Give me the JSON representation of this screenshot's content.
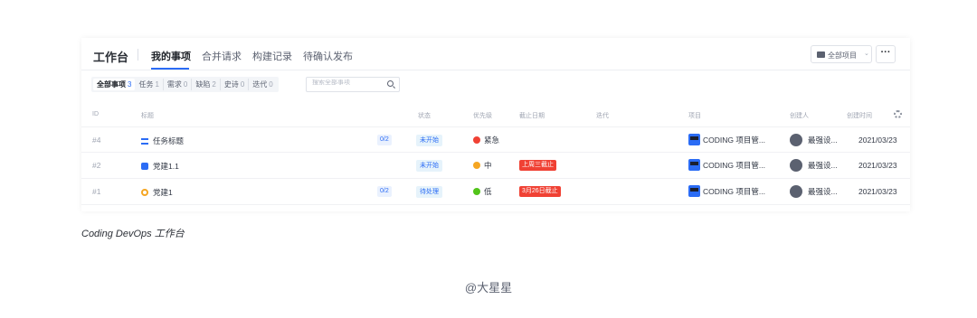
{
  "header": {
    "title": "工作台",
    "tabs": [
      {
        "label": "我的事项",
        "active": true
      },
      {
        "label": "合并请求"
      },
      {
        "label": "构建记录"
      },
      {
        "label": "待确认发布"
      }
    ],
    "project_select": "全部项目",
    "project_caret": "⌄",
    "more": "···"
  },
  "filters": [
    {
      "label": "全部事项",
      "count": "3",
      "active": true
    },
    {
      "label": "任务",
      "count": "1"
    },
    {
      "label": "需求",
      "count": "0"
    },
    {
      "label": "缺陷",
      "count": "2"
    },
    {
      "label": "史诗",
      "count": "0"
    },
    {
      "label": "迭代",
      "count": "0"
    }
  ],
  "search": {
    "placeholder": "搜索全部事项"
  },
  "table": {
    "columns": [
      "ID",
      "标题",
      "状态",
      "优先级",
      "截止日期",
      "迭代",
      "项目",
      "创建人",
      "创建时间"
    ],
    "rows": [
      {
        "id": "#4",
        "type": "task",
        "title": "任务标题",
        "subtasks": "0/2",
        "status": "未开始",
        "priority": "紧急",
        "priority_color": "#f04134",
        "due": "",
        "project": "CODING 项目管...",
        "creator": "最强设...",
        "created": "2021/03/23"
      },
      {
        "id": "#2",
        "type": "requirement",
        "title": "党建1.1",
        "subtasks": "",
        "status": "未开始",
        "priority": "中",
        "priority_color": "#f5a623",
        "due": "上周三截止",
        "project": "CODING 项目管...",
        "creator": "最强设...",
        "created": "2021/03/23"
      },
      {
        "id": "#1",
        "type": "subtask",
        "title": "党建1",
        "subtasks": "0/2",
        "status": "待处理",
        "priority": "低",
        "priority_color": "#52c41a",
        "due": "3月26日截止",
        "project": "CODING 项目管...",
        "creator": "最强设...",
        "created": "2021/03/23"
      }
    ]
  },
  "caption": "Coding DevOps 工作台",
  "credit": "@大星星",
  "colors": {
    "accent": "#2b6cf5",
    "danger": "#f04134"
  }
}
